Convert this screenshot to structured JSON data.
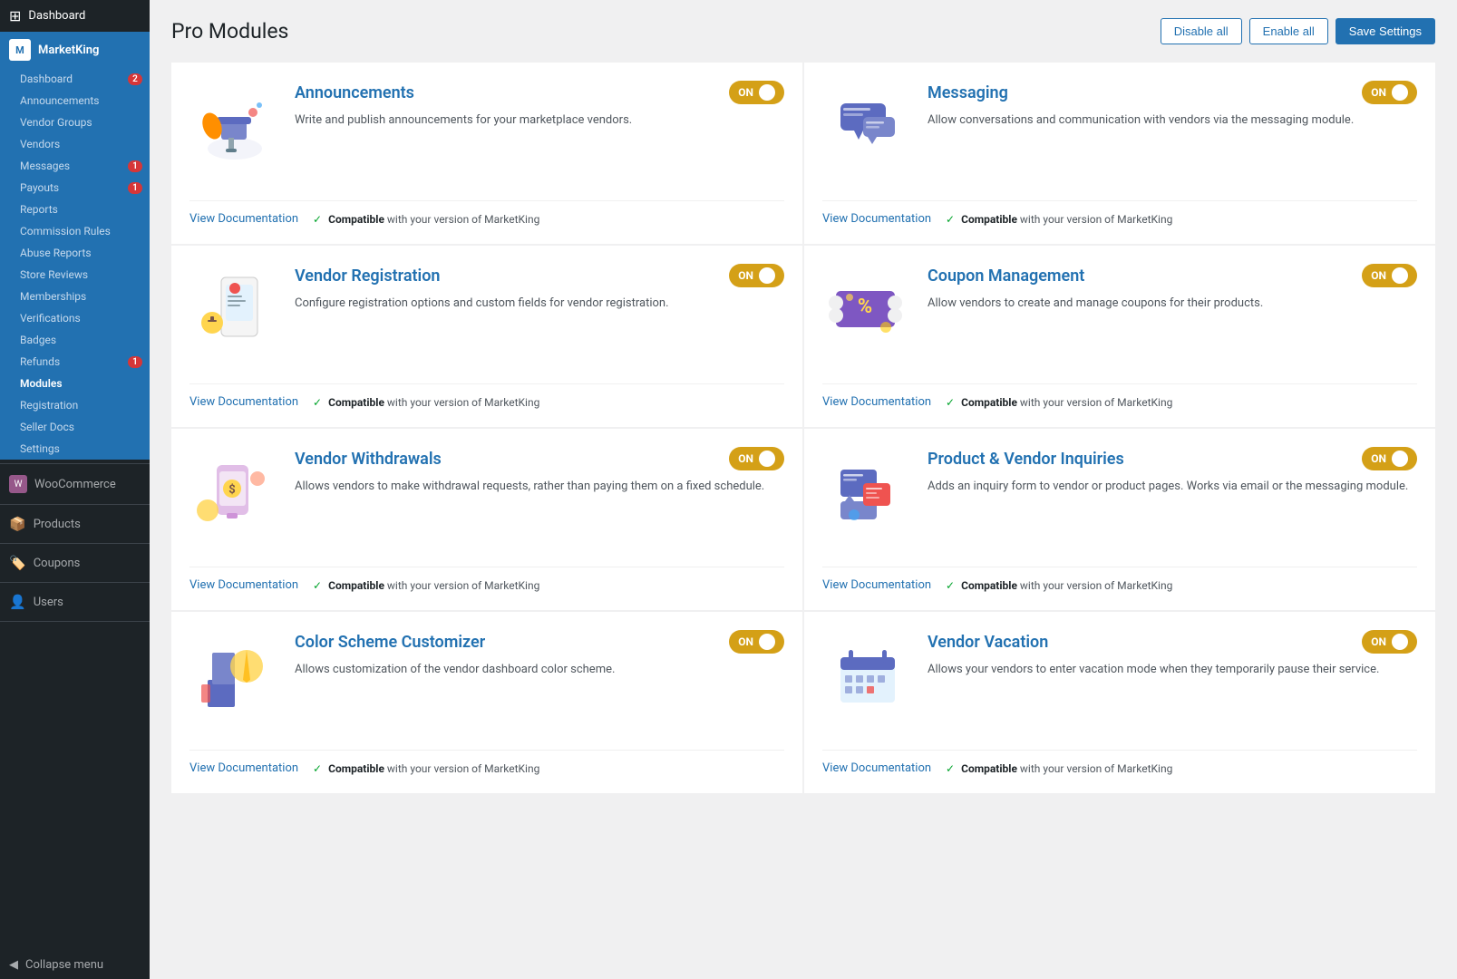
{
  "sidebar": {
    "dashboard_label": "Dashboard",
    "marketking_label": "MarketKing",
    "dashboard_sub": "Dashboard",
    "dashboard_badge": "2",
    "announcements": "Announcements",
    "vendor_groups": "Vendor Groups",
    "vendors": "Vendors",
    "messages": "Messages",
    "messages_badge": "1",
    "payouts": "Payouts",
    "payouts_badge": "1",
    "reports": "Reports",
    "commission_rules": "Commission Rules",
    "abuse_reports": "Abuse Reports",
    "store_reviews": "Store Reviews",
    "memberships": "Memberships",
    "verifications": "Verifications",
    "badges": "Badges",
    "refunds": "Refunds",
    "refunds_badge": "1",
    "modules": "Modules",
    "registration": "Registration",
    "seller_docs": "Seller Docs",
    "settings": "Settings",
    "woocommerce": "WooCommerce",
    "products": "Products",
    "coupons": "Coupons",
    "users": "Users",
    "collapse_menu": "Collapse menu"
  },
  "header": {
    "title": "Pro Modules",
    "disable_all": "Disable all",
    "enable_all": "Enable all",
    "save_settings": "Save Settings"
  },
  "modules": [
    {
      "id": "announcements",
      "title": "Announcements",
      "description": "Write and publish announcements for your marketplace vendors.",
      "toggle": "ON",
      "docs_label": "View Documentation",
      "compatible": "Compatible",
      "compatible_text": "with your version of MarketKing",
      "color": "#2271b1"
    },
    {
      "id": "messaging",
      "title": "Messaging",
      "description": "Allow conversations and communication with vendors via the messaging module.",
      "toggle": "ON",
      "docs_label": "View Documentation",
      "compatible": "Compatible",
      "compatible_text": "with your version of MarketKing",
      "color": "#2271b1"
    },
    {
      "id": "vendor-registration",
      "title": "Vendor Registration",
      "description": "Configure registration options and custom fields for vendor registration.",
      "toggle": "ON",
      "docs_label": "View Documentation",
      "compatible": "Compatible",
      "compatible_text": "with your version of MarketKing",
      "color": "#2271b1"
    },
    {
      "id": "coupon-management",
      "title": "Coupon Management",
      "description": "Allow vendors to create and manage coupons for their products.",
      "toggle": "ON",
      "docs_label": "View Documentation",
      "compatible": "Compatible",
      "compatible_text": "with your version of MarketKing",
      "color": "#2271b1"
    },
    {
      "id": "vendor-withdrawals",
      "title": "Vendor Withdrawals",
      "description": "Allows vendors to make withdrawal requests, rather than paying them on a fixed schedule.",
      "toggle": "ON",
      "docs_label": "View Documentation",
      "compatible": "Compatible",
      "compatible_text": "with your version of MarketKing",
      "color": "#2271b1"
    },
    {
      "id": "product-vendor-inquiries",
      "title": "Product & Vendor Inquiries",
      "description": "Adds an inquiry form to vendor or product pages. Works via email or the messaging module.",
      "toggle": "ON",
      "docs_label": "View Documentation",
      "compatible": "Compatible",
      "compatible_text": "with your version of MarketKing",
      "color": "#2271b1"
    },
    {
      "id": "color-scheme-customizer",
      "title": "Color Scheme Customizer",
      "description": "Allows customization of the vendor dashboard color scheme.",
      "toggle": "ON",
      "docs_label": "View Documentation",
      "compatible": "Compatible",
      "compatible_text": "with your version of MarketKing",
      "color": "#2271b1"
    },
    {
      "id": "vendor-vacation",
      "title": "Vendor Vacation",
      "description": "Allows your vendors to enter vacation mode when they temporarily pause their service.",
      "toggle": "ON",
      "docs_label": "View Documentation",
      "compatible": "Compatible",
      "compatible_text": "with your version of MarketKing",
      "color": "#2271b1"
    }
  ]
}
